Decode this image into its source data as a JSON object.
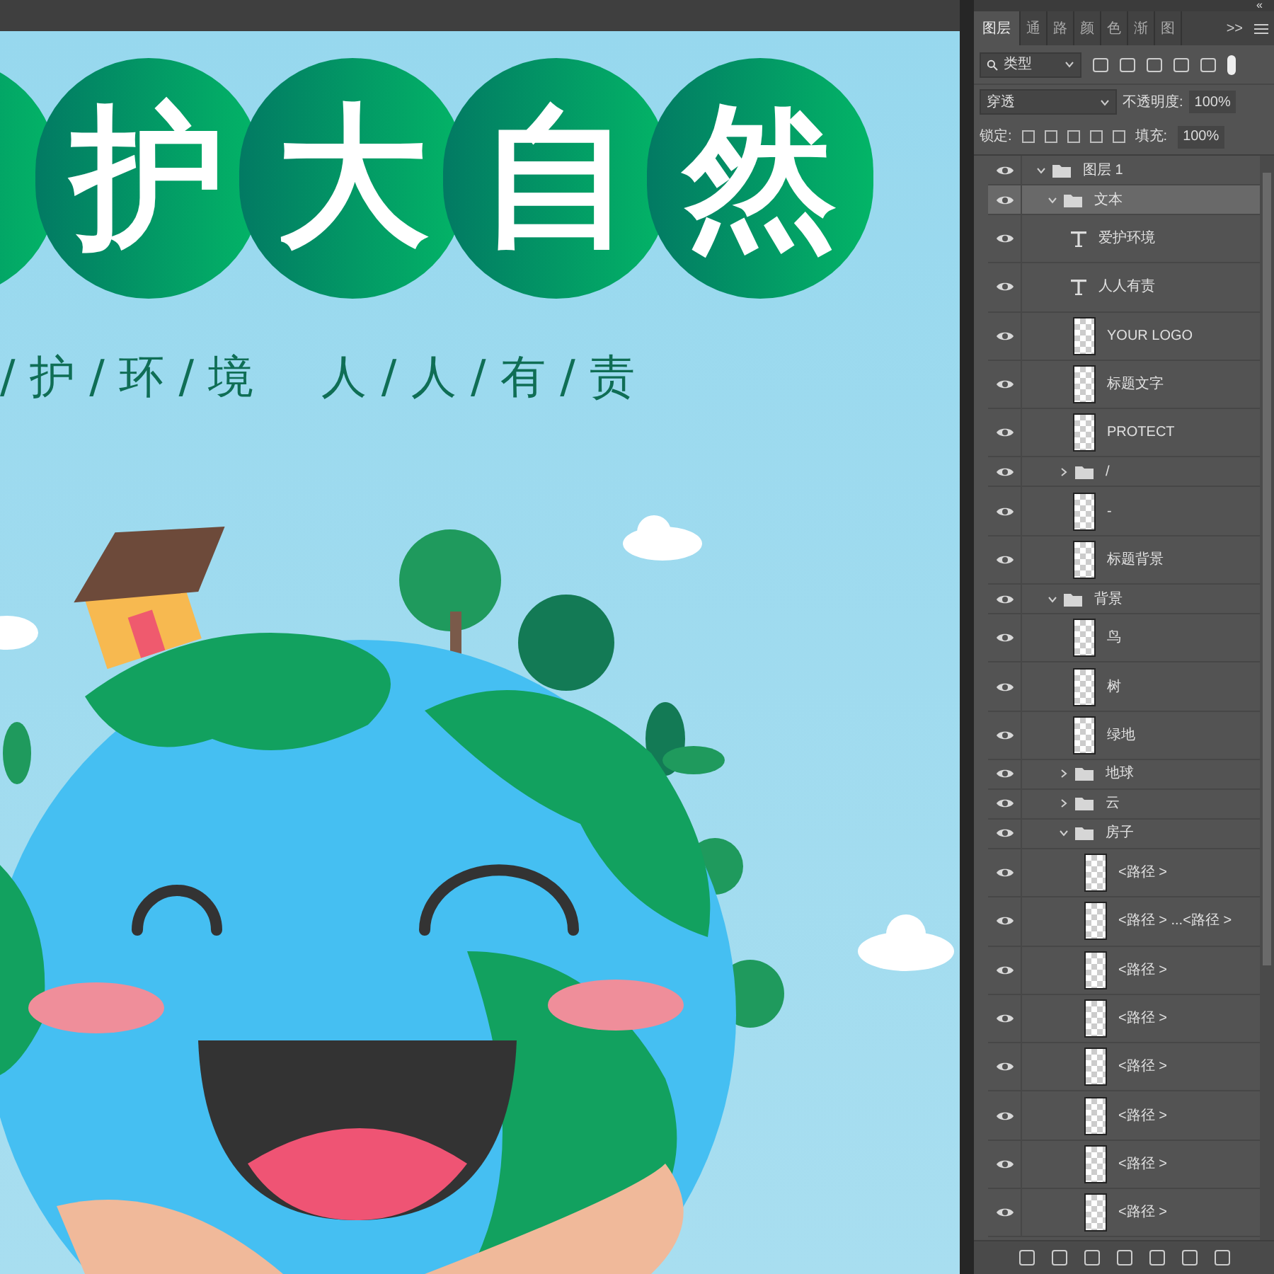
{
  "poster": {
    "title_chars": [
      {
        "char": "护"
      },
      {
        "char": "大"
      },
      {
        "char": "自"
      },
      {
        "char": "然"
      }
    ],
    "subtitle_left": "/ 护 / 环 / 境",
    "subtitle_right": "人 / 人 / 有 / 责"
  },
  "panel": {
    "collapse_glyph": "«",
    "tabs": [
      {
        "label": "图层",
        "selected": true
      },
      {
        "label": "通",
        "selected": false
      },
      {
        "label": "路",
        "selected": false
      },
      {
        "label": "颜",
        "selected": false
      },
      {
        "label": "色",
        "selected": false
      },
      {
        "label": "渐",
        "selected": false
      },
      {
        "label": "图",
        "selected": false
      }
    ],
    "more_glyph": ">>",
    "filter": {
      "value": "类型"
    },
    "blend": {
      "value": "穿透"
    },
    "opacity": {
      "label": "不透明度:",
      "value": "100%"
    },
    "lock": {
      "label": "锁定:"
    },
    "fill": {
      "label": "填充:",
      "value": "100%"
    },
    "layers": [
      {
        "name": "图层 1",
        "kind": "folder",
        "expanded": true,
        "selected": false,
        "visible": true,
        "children": [
          {
            "name": "文本",
            "kind": "folder",
            "expanded": true,
            "selected": true,
            "visible": true,
            "children": [
              {
                "name": "爱护环境",
                "kind": "text",
                "selected": false,
                "visible": true
              },
              {
                "name": "人人有责",
                "kind": "text",
                "selected": false,
                "visible": true
              },
              {
                "name": "YOUR LOGO",
                "kind": "pixel",
                "selected": false,
                "visible": true
              },
              {
                "name": "标题文字",
                "kind": "pixel",
                "selected": false,
                "visible": true
              },
              {
                "name": "PROTECT",
                "kind": "pixel",
                "selected": false,
                "visible": true
              },
              {
                "name": "/",
                "kind": "folder",
                "expanded": false,
                "selected": false,
                "visible": true
              },
              {
                "name": "-",
                "kind": "pixel",
                "selected": false,
                "visible": true
              },
              {
                "name": "标题背景",
                "kind": "pixel",
                "selected": false,
                "visible": true
              }
            ]
          },
          {
            "name": "背景",
            "kind": "folder",
            "expanded": true,
            "selected": false,
            "visible": true,
            "children": [
              {
                "name": "鸟",
                "kind": "pixel",
                "selected": false,
                "visible": true
              },
              {
                "name": "树",
                "kind": "pixel",
                "selected": false,
                "visible": true
              },
              {
                "name": "绿地",
                "kind": "pixel",
                "selected": false,
                "visible": true
              },
              {
                "name": "地球",
                "kind": "folder",
                "expanded": false,
                "selected": false,
                "visible": true
              },
              {
                "name": "云",
                "kind": "folder",
                "expanded": false,
                "selected": false,
                "visible": true
              },
              {
                "name": "房子",
                "kind": "folder",
                "expanded": true,
                "selected": false,
                "visible": true,
                "children": [
                  {
                    "name": "<路径 >",
                    "kind": "pixel",
                    "selected": false,
                    "visible": true
                  },
                  {
                    "name": "<路径 > ...<路径 >",
                    "kind": "pixel",
                    "selected": false,
                    "visible": true
                  },
                  {
                    "name": "<路径 >",
                    "kind": "pixel",
                    "selected": false,
                    "visible": true
                  },
                  {
                    "name": "<路径 >",
                    "kind": "pixel",
                    "selected": false,
                    "visible": true
                  },
                  {
                    "name": "<路径 >",
                    "kind": "pixel",
                    "selected": false,
                    "visible": true
                  },
                  {
                    "name": "<路径 >",
                    "kind": "pixel",
                    "selected": false,
                    "visible": true
                  },
                  {
                    "name": "<路径 >",
                    "kind": "pixel",
                    "selected": false,
                    "visible": true
                  },
                  {
                    "name": "<路径 >",
                    "kind": "pixel",
                    "selected": false,
                    "visible": true
                  }
                ]
              }
            ]
          }
        ]
      }
    ]
  }
}
